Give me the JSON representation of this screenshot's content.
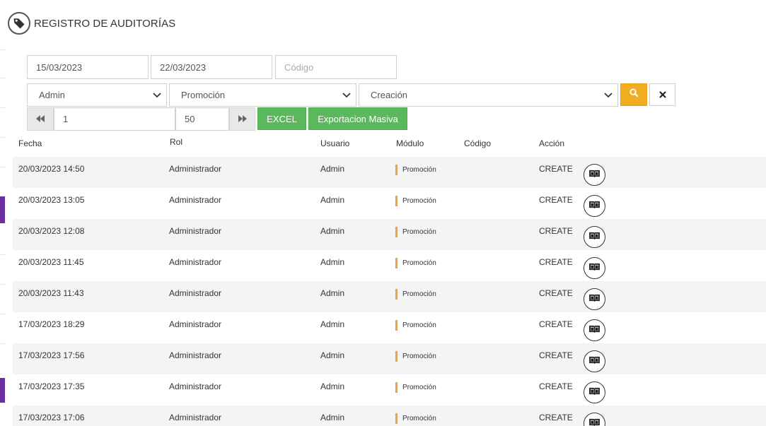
{
  "header": {
    "title": "REGISTRO DE AUDITORÍAS",
    "icon": "tag-icon"
  },
  "filters": {
    "date_from": "15/03/2023",
    "date_to": "22/03/2023",
    "code_placeholder": "Código",
    "user_select": "Admin",
    "module_select": "Promoción",
    "action_select": "Creación"
  },
  "pager": {
    "page": "1",
    "page_size": "50"
  },
  "buttons": {
    "excel": "EXCEL",
    "mass_export": "Exportacion Masiva"
  },
  "table": {
    "headers": {
      "date": "Fecha",
      "role": "Rol",
      "user": "Usuario",
      "module": "Módulo",
      "code": "Código",
      "action": "Acción"
    },
    "rows": [
      {
        "date": "20/03/2023 14:50",
        "role": "Administrador",
        "user": "Admin",
        "module": "Promoción",
        "code": "",
        "action": "CREATE"
      },
      {
        "date": "20/03/2023 13:05",
        "role": "Administrador",
        "user": "Admin",
        "module": "Promoción",
        "code": "",
        "action": "CREATE"
      },
      {
        "date": "20/03/2023 12:08",
        "role": "Administrador",
        "user": "Admin",
        "module": "Promoción",
        "code": "",
        "action": "CREATE"
      },
      {
        "date": "20/03/2023 11:45",
        "role": "Administrador",
        "user": "Admin",
        "module": "Promoción",
        "code": "",
        "action": "CREATE"
      },
      {
        "date": "20/03/2023 11:43",
        "role": "Administrador",
        "user": "Admin",
        "module": "Promoción",
        "code": "",
        "action": "CREATE"
      },
      {
        "date": "17/03/2023 18:29",
        "role": "Administrador",
        "user": "Admin",
        "module": "Promoción",
        "code": "",
        "action": "CREATE"
      },
      {
        "date": "17/03/2023 17:56",
        "role": "Administrador",
        "user": "Admin",
        "module": "Promoción",
        "code": "",
        "action": "CREATE"
      },
      {
        "date": "17/03/2023 17:35",
        "role": "Administrador",
        "user": "Admin",
        "module": "Promoción",
        "code": "",
        "action": "CREATE"
      },
      {
        "date": "17/03/2023 17:06",
        "role": "Administrador",
        "user": "Admin",
        "module": "Promoción",
        "code": "",
        "action": "CREATE"
      }
    ]
  },
  "colors": {
    "accent_orange": "#f0ad1f",
    "green": "#5cb85c",
    "module_marker": "#f0a23b",
    "sidebar_active": "#6b2fa0"
  }
}
